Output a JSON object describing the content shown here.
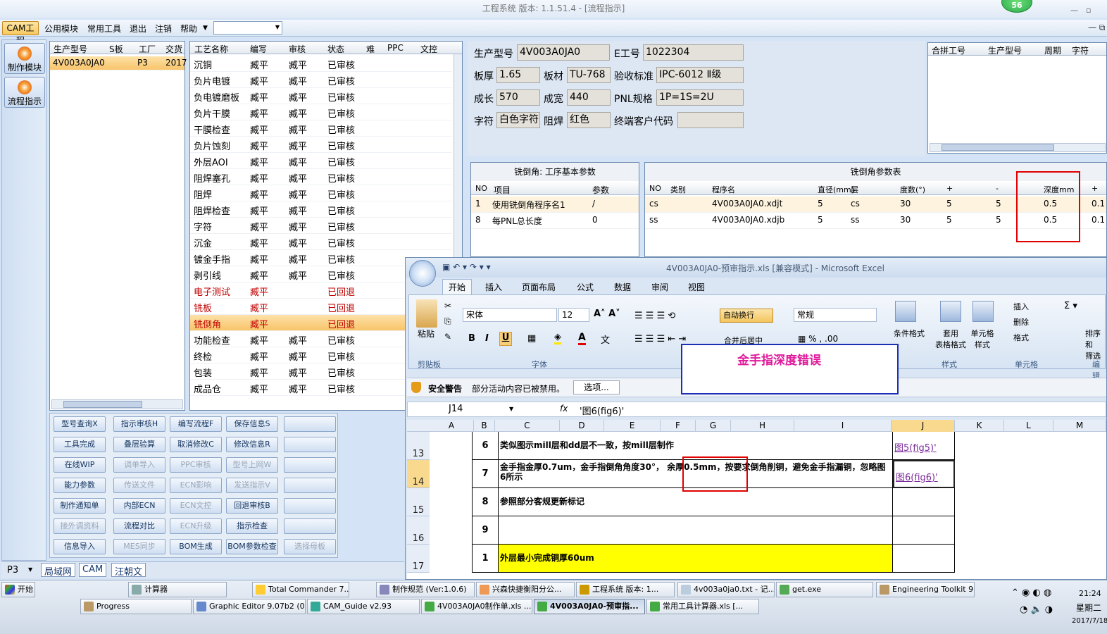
{
  "window": {
    "title": "工程系统  版本: 1.1.51.4 - [流程指示]",
    "badge": "56"
  },
  "menu": {
    "active": "CAM工程",
    "items": [
      "公用模块",
      "常用工具",
      "退出",
      "注销",
      "帮助"
    ]
  },
  "nav": {
    "btn1": "制作模块",
    "btn2": "流程指示"
  },
  "model_grid": {
    "headers": [
      "生产型号",
      "S板",
      "工厂",
      "交货"
    ],
    "row": [
      "4V003A0JA0",
      "",
      "P3",
      "2017"
    ]
  },
  "process_grid": {
    "headers": [
      "工艺名称",
      "编写",
      "审核",
      "状态",
      "难",
      "PPC",
      "文控"
    ],
    "rows": [
      {
        "name": "沉铜",
        "writer": "臧平",
        "reviewer": "臧平",
        "status": "已审核"
      },
      {
        "name": "负片电镀",
        "writer": "臧平",
        "reviewer": "臧平",
        "status": "已审核"
      },
      {
        "name": "负电镀磨板",
        "writer": "臧平",
        "reviewer": "臧平",
        "status": "已审核"
      },
      {
        "name": "负片干膜",
        "writer": "臧平",
        "reviewer": "臧平",
        "status": "已审核"
      },
      {
        "name": "干膜检查",
        "writer": "臧平",
        "reviewer": "臧平",
        "status": "已审核"
      },
      {
        "name": "负片蚀刻",
        "writer": "臧平",
        "reviewer": "臧平",
        "status": "已审核"
      },
      {
        "name": "外层AOI",
        "writer": "臧平",
        "reviewer": "臧平",
        "status": "已审核"
      },
      {
        "name": "阻焊塞孔",
        "writer": "臧平",
        "reviewer": "臧平",
        "status": "已审核"
      },
      {
        "name": "阻焊",
        "writer": "臧平",
        "reviewer": "臧平",
        "status": "已审核"
      },
      {
        "name": "阻焊检查",
        "writer": "臧平",
        "reviewer": "臧平",
        "status": "已审核"
      },
      {
        "name": "字符",
        "writer": "臧平",
        "reviewer": "臧平",
        "status": "已审核"
      },
      {
        "name": "沉金",
        "writer": "臧平",
        "reviewer": "臧平",
        "status": "已审核"
      },
      {
        "name": "镀金手指",
        "writer": "臧平",
        "reviewer": "臧平",
        "status": "已审核"
      },
      {
        "name": "剥引线",
        "writer": "臧平",
        "reviewer": "臧平",
        "status": "已审核"
      },
      {
        "name": "电子测试",
        "writer": "臧平",
        "reviewer": "",
        "status": "已回退"
      },
      {
        "name": "铣板",
        "writer": "臧平",
        "reviewer": "",
        "status": "已回退"
      },
      {
        "name": "铣倒角",
        "writer": "臧平",
        "reviewer": "",
        "status": "已回退"
      },
      {
        "name": "功能检查",
        "writer": "臧平",
        "reviewer": "臧平",
        "status": "已审核"
      },
      {
        "name": "终检",
        "writer": "臧平",
        "reviewer": "臧平",
        "status": "已审核"
      },
      {
        "name": "包装",
        "writer": "臧平",
        "reviewer": "臧平",
        "status": "已审核"
      },
      {
        "name": "成品仓",
        "writer": "臧平",
        "reviewer": "臧平",
        "status": "已审核"
      }
    ]
  },
  "actions": [
    [
      "型号查询X",
      "指示审核H",
      "编写流程F",
      "保存信息S",
      ""
    ],
    [
      "工具完成",
      "叠层验算",
      "取消修改C",
      "修改信息R",
      ""
    ],
    [
      "在线WIP",
      "调单导入",
      "PPC审核",
      "型号上网W",
      ""
    ],
    [
      "能力参数",
      "传送文件",
      "ECN影响",
      "发送指示V",
      ""
    ],
    [
      "制作通知单",
      "内部ECN",
      "ECN文控",
      "回退审核B",
      ""
    ],
    [
      "接外调资料",
      "流程对比",
      "ECN升级",
      "指示检查",
      ""
    ],
    [
      "信息导入",
      "MES同步",
      "BOM生成",
      "BOM参数检查",
      "选择母板"
    ]
  ],
  "bottom_tabs": {
    "combo": "P3",
    "tabs": [
      "局域网",
      "CAM",
      "汪朝文"
    ]
  },
  "info": {
    "model_label": "生产型号",
    "model": "4V003A0JA0",
    "eno_label": "E工号",
    "eno": "1022304",
    "thick_label": "板厚",
    "thick": "1.65",
    "mat_label": "板材",
    "mat": "TU-768",
    "std_label": "验收标准",
    "std": "IPC-6012 Ⅱ级",
    "len_label": "成长",
    "len": "570",
    "wid_label": "成宽",
    "wid": "440",
    "pnl_label": "PNL规格",
    "pnl": "1P=1S=2U",
    "char_label": "字符",
    "char": "白色字符",
    "mask_label": "阻焊",
    "mask": "红色",
    "cust_label": "终端客户代码",
    "cust": ""
  },
  "merge_grid": {
    "headers": [
      "合拼工号",
      "生产型号",
      "周期",
      "字符"
    ]
  },
  "chamfer_basic": {
    "title": "铣倒角: 工序基本参数",
    "headers": [
      "NO",
      "项目",
      "参数"
    ],
    "rows": [
      [
        "1",
        "使用铣倒角程序名1",
        "/"
      ],
      [
        "8",
        "每PNL总长度",
        "0"
      ]
    ]
  },
  "chamfer_params": {
    "title": "铣倒角参数表",
    "headers": [
      "NO",
      "类别",
      "程序名",
      "直径(mm)",
      "层",
      "度数(°)",
      "+",
      "-",
      "深度mm",
      "+"
    ],
    "rows": [
      [
        "cs",
        "",
        "4V003A0JA0.xdjt",
        "5",
        "cs",
        "30",
        "5",
        "5",
        "0.5",
        "0.1"
      ],
      [
        "ss",
        "",
        "4V003A0JA0.xdjb",
        "5",
        "ss",
        "30",
        "5",
        "5",
        "0.5",
        "0.1"
      ]
    ]
  },
  "excel": {
    "title": "4V003A0JA0-预审指示.xls  [兼容模式] - Microsoft Excel",
    "tabs": [
      "开始",
      "插入",
      "页面布局",
      "公式",
      "数据",
      "审阅",
      "视图"
    ],
    "font": "宋体",
    "size": "12",
    "numfmt": "常规",
    "paste": "粘贴",
    "wrap": "自动换行",
    "merge": "合并后居中",
    "cond": "条件格式",
    "tablefmt": "套用\n表格格式",
    "cellstyle": "单元格\n样式",
    "insert": "插入",
    "delete": "删除",
    "format": "格式",
    "sort": "排序和\n筛选",
    "groups": [
      "剪贴板",
      "字体",
      "样式",
      "单元格",
      "编辑"
    ],
    "security_label": "安全警告",
    "security_msg": "部分活动内容已被禁用。",
    "options": "选项...",
    "namebox": "J14",
    "fx": "fx",
    "formula": "'图6(fig6)'",
    "cols": [
      "A",
      "B",
      "C",
      "D",
      "E",
      "F",
      "G",
      "H",
      "I",
      "J",
      "K",
      "L",
      "M"
    ],
    "rows": [
      {
        "rownum": "13",
        "no": "6",
        "text": "类似图示mill层和dd层不一致，按mill层制作",
        "link": "图5(fig5)'"
      },
      {
        "rownum": "14",
        "no": "7",
        "text": "金手指金厚0.7um，金手指倒角角度30°， 余厚0.5mm，按要求倒角削铜，避免金手指漏铜，忽略图6所示",
        "link": "图6(fig6)'"
      },
      {
        "rownum": "15",
        "no": "8",
        "text": "参照部分客规更新标记",
        "link": ""
      },
      {
        "rownum": "16",
        "no": "9",
        "text": "",
        "link": ""
      },
      {
        "rownum": "17",
        "no": "1",
        "text": "外层最小完成铜厚60um",
        "link": ""
      }
    ]
  },
  "annotation": {
    "text": "金手指深度错误"
  },
  "taskbar": {
    "start": "开始",
    "row1": [
      "计算器",
      "Total Commander 7....",
      "制作规范 (Ver:1.0.6)",
      "兴森快捷衡阳分公...",
      "工程系统  版本: 1...",
      "4v003a0ja0.txt - 记...",
      "get.exe",
      "Engineering Toolkit 9..."
    ],
    "row2": [
      "Progress",
      "Graphic Editor 9.07b2 (0...",
      "CAM_Guide v2.93",
      "4V003A0JA0制作单.xls ...",
      "4V003A0JA0-预审指...",
      "常用工具计算器.xls [..."
    ],
    "time": "21:24",
    "weekday": "星期二",
    "date": "2017/7/18"
  }
}
